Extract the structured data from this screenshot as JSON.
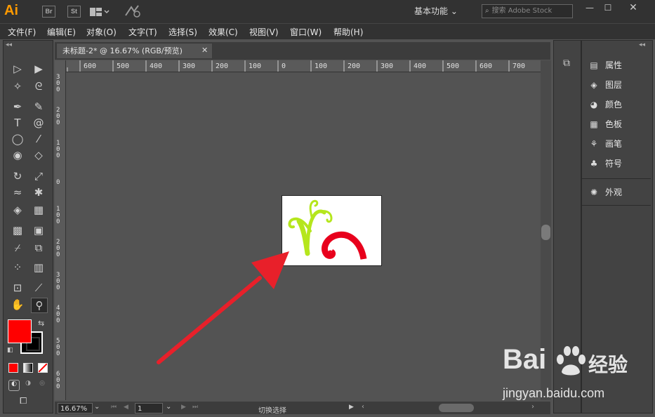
{
  "app": {
    "logo": "Ai",
    "badges": [
      "Br",
      "St"
    ],
    "workspace_label": "基本功能",
    "search_placeholder": "搜索 Adobe Stock"
  },
  "menu": [
    "文件(F)",
    "编辑(E)",
    "对象(O)",
    "文字(T)",
    "选择(S)",
    "效果(C)",
    "视图(V)",
    "窗口(W)",
    "帮助(H)"
  ],
  "document": {
    "tab_title": "未标题-2* @ 16.67% (RGB/预览)",
    "ruler_top": [
      "600",
      "500",
      "400",
      "300",
      "200",
      "100",
      "0",
      "100",
      "200",
      "300",
      "400",
      "500",
      "600",
      "700"
    ],
    "ruler_left": [
      "3 0 0",
      "2 0 0",
      "1 0 0",
      "0",
      "1 0 0",
      "2 0 0",
      "3 0 0",
      "4 0 0",
      "5 0 0",
      "6 0 0"
    ]
  },
  "statusbar": {
    "zoom": "16.67%",
    "page": "1",
    "status_text": "切换选择"
  },
  "panels": [
    {
      "label": "属性",
      "icon": "properties-icon"
    },
    {
      "label": "图层",
      "icon": "layers-icon"
    },
    {
      "label": "颜色",
      "icon": "color-icon"
    },
    {
      "label": "色板",
      "icon": "swatches-icon"
    },
    {
      "label": "画笔",
      "icon": "brushes-icon"
    },
    {
      "label": "符号",
      "icon": "symbols-icon"
    },
    {
      "label": "外观",
      "icon": "appearance-icon"
    }
  ],
  "colors": {
    "fill": "#ff0000",
    "stroke": "#000000",
    "vine": "#b5e61d",
    "swirl": "#e8001c",
    "arrow": "#e8202a"
  },
  "watermark": {
    "brand": "Bai",
    "brand_cn": "经验",
    "url": "jingyan.baidu.com"
  }
}
